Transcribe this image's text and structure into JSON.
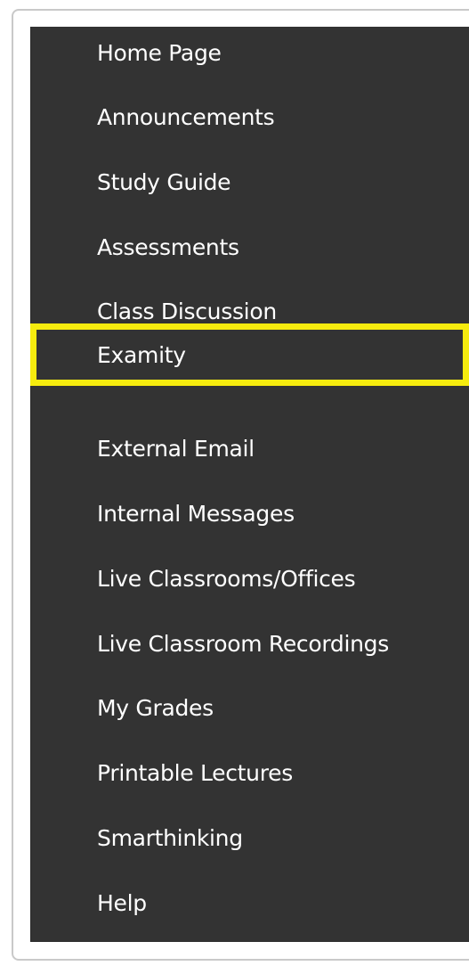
{
  "nav": {
    "items": [
      {
        "label": "Home Page"
      },
      {
        "label": "Announcements"
      },
      {
        "label": "Study Guide"
      },
      {
        "label": "Assessments"
      },
      {
        "label": "Class Discussion"
      },
      {
        "label": "Examity",
        "highlighted": true
      },
      {
        "label": "External Email"
      },
      {
        "label": "Internal Messages"
      },
      {
        "label": "Live Classrooms/Offices"
      },
      {
        "label": "Live Classroom Recordings"
      },
      {
        "label": "My Grades"
      },
      {
        "label": "Printable Lectures"
      },
      {
        "label": "Smarthinking"
      },
      {
        "label": "Help"
      }
    ]
  },
  "colors": {
    "menu_background": "#333333",
    "text": "#ffffff",
    "highlight_border": "#f6ec0e",
    "frame_border": "#c9c9c9"
  }
}
